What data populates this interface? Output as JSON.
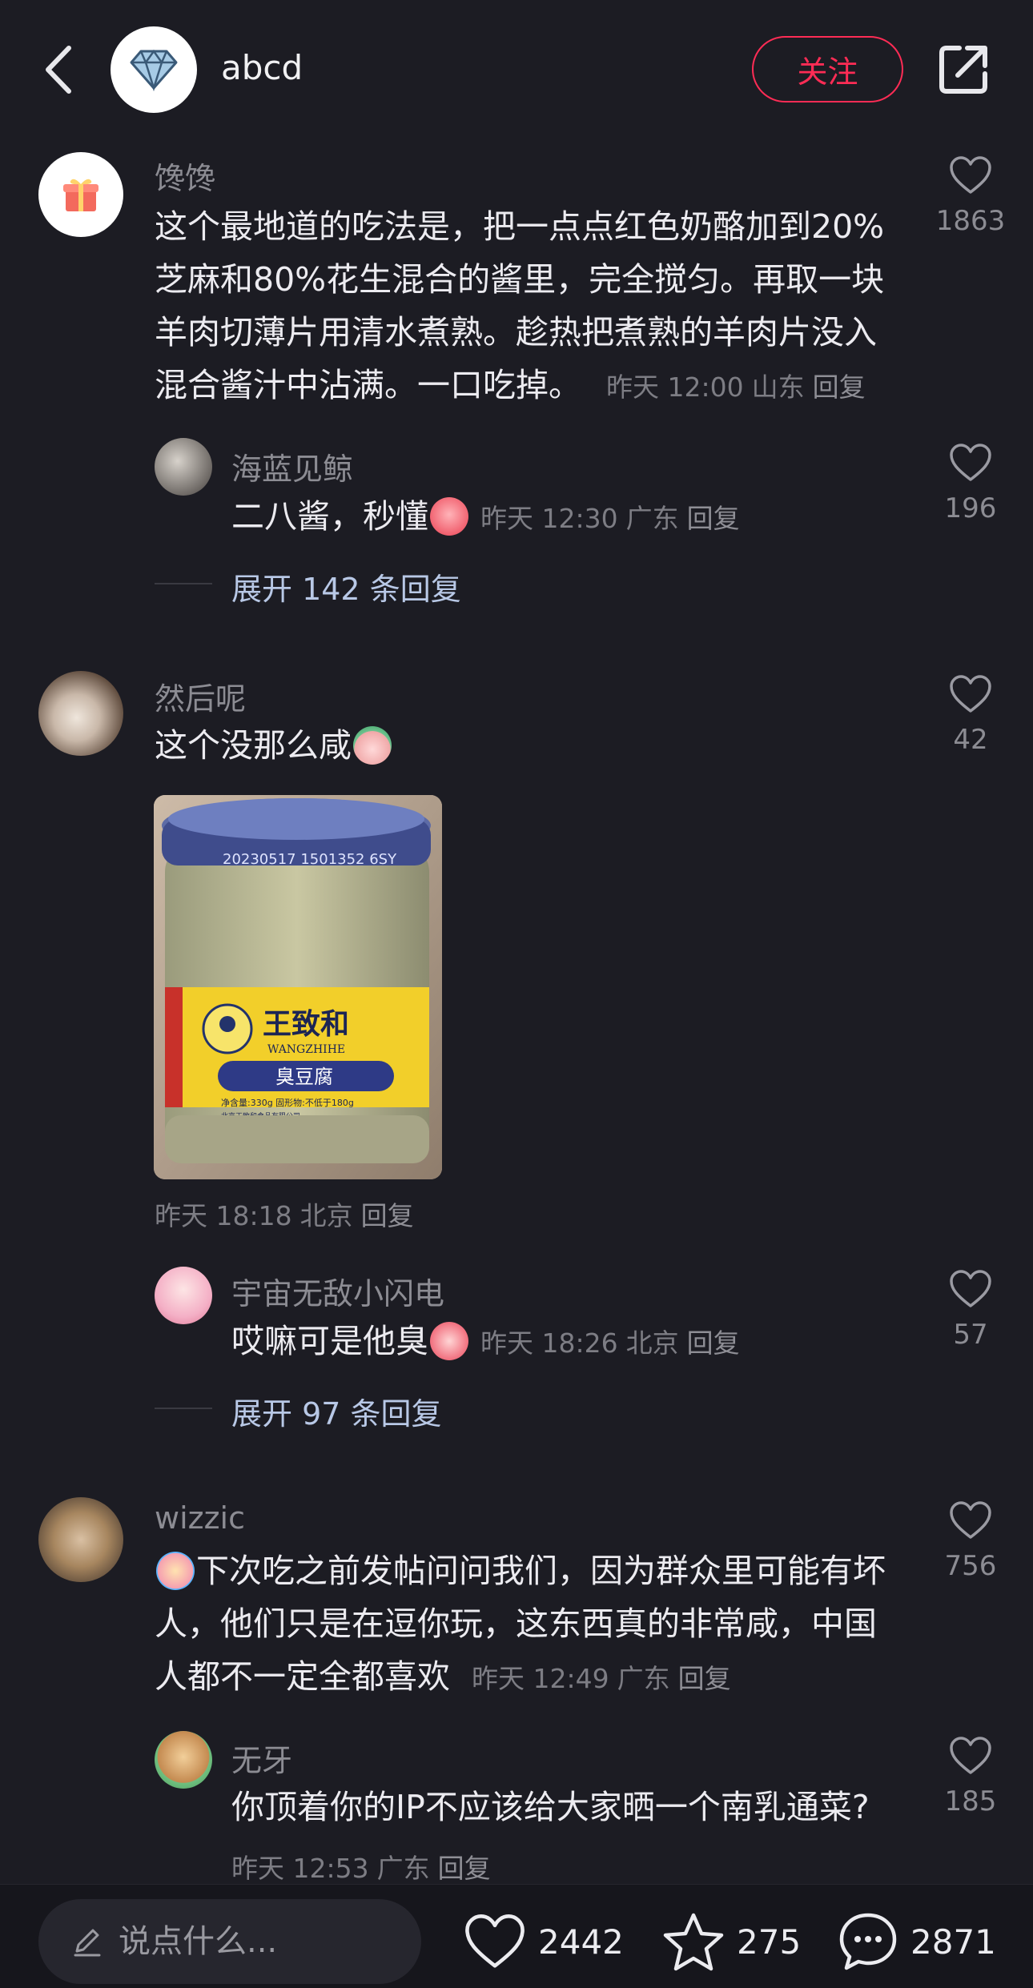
{
  "header": {
    "author_name": "abcd",
    "follow_label": "关注",
    "accent_color": "#fe2c55"
  },
  "comments": [
    {
      "username": "馋馋",
      "text_lines": [
        "这个最地道的吃法是，把一点点红色奶酪加到20%",
        "芝麻和80%花生混合的酱里，完全搅匀。再取一块",
        "羊肉切薄片用清水煮熟。趁热把煮熟的羊肉片没入",
        "混合酱汁中沾满。一口吃掉。"
      ],
      "time": "昨天 12:00",
      "location": "山东",
      "reply_label": "回复",
      "likes": "1863",
      "replies": [
        {
          "username": "海蓝见鲸",
          "text": "二八酱，秒懂",
          "time": "昨天 12:30",
          "location": "广东",
          "reply_label": "回复",
          "likes": "196"
        }
      ],
      "expand_label": "展开 142 条回复"
    },
    {
      "username": "然后呢",
      "text": "这个没那么咸",
      "image_label": "jar photo",
      "jar": {
        "lid_print": "20230517  1501352 6SY",
        "brand_cn": "王致和",
        "brand_en": "WANGZHIHE",
        "product": "臭豆腐",
        "net": "净含量:330g  固形物:不低于180g",
        "maker": "北京王致和食品有限公司"
      },
      "time": "昨天 18:18",
      "location": "北京",
      "reply_label": "回复",
      "likes": "42",
      "replies": [
        {
          "username": "宇宙无敌小闪电",
          "text": "哎嘛可是他臭",
          "time": "昨天 18:26",
          "location": "北京",
          "reply_label": "回复",
          "likes": "57"
        }
      ],
      "expand_label": "展开 97 条回复"
    },
    {
      "username": "wizzic",
      "text_lines": [
        "下次吃之前发帖问问我们，因为群众里可能有坏",
        "人，他们只是在逗你玩，这东西真的非常咸，中国",
        "人都不一定全都喜欢"
      ],
      "time": "昨天 12:49",
      "location": "广东",
      "reply_label": "回复",
      "likes": "756",
      "replies": [
        {
          "username": "无牙",
          "text": "你顶着你的IP不应该给大家晒一个南乳通菜?",
          "time": "昨天 12:53",
          "location": "广东",
          "reply_label": "回复",
          "likes": "185"
        }
      ]
    }
  ],
  "bottom_bar": {
    "input_placeholder": "说点什么...",
    "likes": "2442",
    "favorites": "275",
    "comments": "2871"
  }
}
